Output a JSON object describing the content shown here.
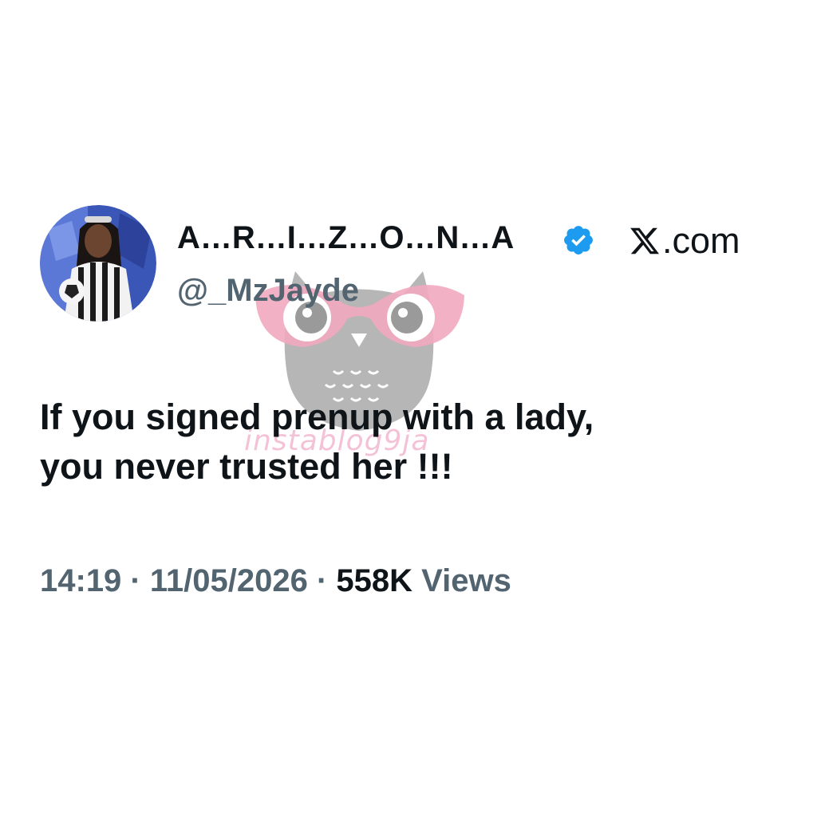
{
  "user": {
    "display_name": "A…R…I…Z…O…N…A",
    "handle": "@_MzJayde",
    "verified": true,
    "avatar_icon": "profile-photo"
  },
  "platform": {
    "logo_icon": "x-logo-icon",
    "label": ".com"
  },
  "tweet": {
    "line1": "If you signed prenup with a lady,",
    "line2": "you never trusted her !!!"
  },
  "meta": {
    "time": "14:19",
    "separator": " · ",
    "date": "11/05/2026",
    "views_count": "558K",
    "views_label": " Views"
  },
  "watermark": {
    "text": "instablog9ja"
  },
  "colors": {
    "text_primary": "#0f1419",
    "text_secondary": "#536471",
    "verified_blue": "#1d9bf0",
    "watermark_pink": "#f3b8cf",
    "watermark_gray": "#a7a7a7"
  }
}
